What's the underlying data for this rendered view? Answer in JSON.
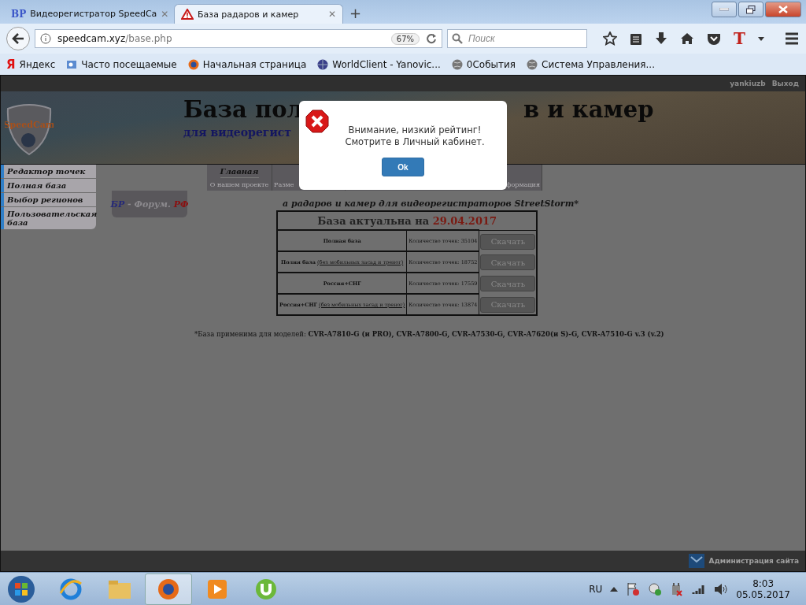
{
  "browser": {
    "tabs": [
      {
        "title": "Видеорегистратор SpeedCa",
        "favicon_text": "ВР",
        "close": "✕",
        "kind": "site",
        "selected": false
      },
      {
        "title": "База радаров и камер",
        "close": "✕",
        "kind": "warning",
        "selected": true
      }
    ],
    "new_tab": "+",
    "url": {
      "host": "speedcam.xyz",
      "path": "/base.php"
    },
    "zoom": "67%",
    "search": {
      "placeholder": "Поиск"
    },
    "toolbar_letter": "T",
    "bookmarks": [
      {
        "label": "Яндекс",
        "kind": "yandex",
        "icon_text": "Я"
      },
      {
        "label": "Часто посещаемые",
        "kind": "folder"
      },
      {
        "label": "Начальная страница",
        "kind": "firefox"
      },
      {
        "label": "WorldClient - Yanovic...",
        "kind": "worldclient"
      },
      {
        "label": "0События",
        "kind": "globe"
      },
      {
        "label": "Система Управления...",
        "kind": "globe"
      }
    ]
  },
  "site": {
    "user": "yankiuzb",
    "logout": "Выход",
    "logo_text": "SpeedCam",
    "title_parts": [
      "База пол",
      "в и камер"
    ],
    "subtitle": "для видеорегист",
    "sidebar": [
      "Редактор точек",
      "Полная база",
      "Выбор регионов",
      "Пользовательская база"
    ],
    "nav_tabs": [
      {
        "title": "Главная",
        "caption": "О нашем проекте"
      },
      {
        "caption": "Разме"
      },
      {
        "caption": "формация"
      }
    ],
    "forum_parts": [
      {
        "text": "БР",
        "color": "#262a78"
      },
      {
        "text": " - Форум. ",
        "color": "#8c8a8e"
      },
      {
        "text": "РФ",
        "color": "#8a1010"
      }
    ],
    "intro": "а радаров и камер для видеорегистраторов StreetStorm*",
    "table": {
      "heading": "База актуальна на ",
      "date": "29.04.2017",
      "rows": [
        {
          "name": "Полная база",
          "count": "Количество точек: 35104",
          "button": "Скачать"
        },
        {
          "name": "Полня база",
          "note": "(без мобильных засад и треног)",
          "count": "Количество точек: 18752",
          "button": "Скачать"
        },
        {
          "name": "Россия+СНГ",
          "count": "Количество точек: 17559",
          "button": "Скачать"
        },
        {
          "name": "Россия+СНГ",
          "note": "(без мобильных засад и треног)",
          "count": "Количество точек: 13874",
          "button": "Скачать"
        }
      ]
    },
    "footnote": "*База применима для моделей: **CVR-A7810-G (и PRO), CVR-A7800-G, CVR-A7530-G, CVR-A7620(и S)-G, CVR-A7510-G v.3 (v.2)**",
    "admin_link": "Администрация сайта"
  },
  "dialog": {
    "message": "Внимание, низкий рейтинг! Смотрите в Личный кабинет.",
    "button": "Ok"
  },
  "taskbar": {
    "apps": [
      {
        "kind": "ie",
        "selected": false
      },
      {
        "kind": "explorer",
        "selected": false
      },
      {
        "kind": "firefox",
        "selected": true
      },
      {
        "kind": "media",
        "selected": false
      },
      {
        "kind": "torrent",
        "selected": false
      }
    ],
    "language": "RU",
    "time": "8:03",
    "date": "05.05.2017"
  }
}
